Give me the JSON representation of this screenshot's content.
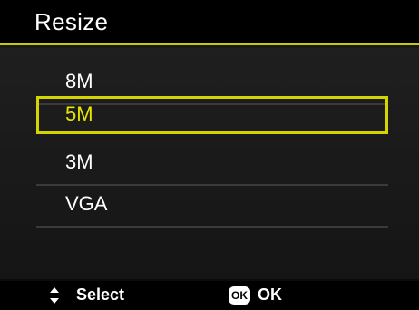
{
  "title": "Resize",
  "menu": {
    "items": [
      {
        "label": "8M"
      },
      {
        "label": "5M"
      },
      {
        "label": "3M"
      },
      {
        "label": "VGA"
      }
    ],
    "selected_index": 1
  },
  "footer": {
    "select_icon": "up-down-arrows-icon",
    "select_label": "Select",
    "ok_icon_text": "OK",
    "ok_label": "OK"
  },
  "colors": {
    "accent": "#d4d400",
    "background": "#000000",
    "text": "#ffffff"
  }
}
